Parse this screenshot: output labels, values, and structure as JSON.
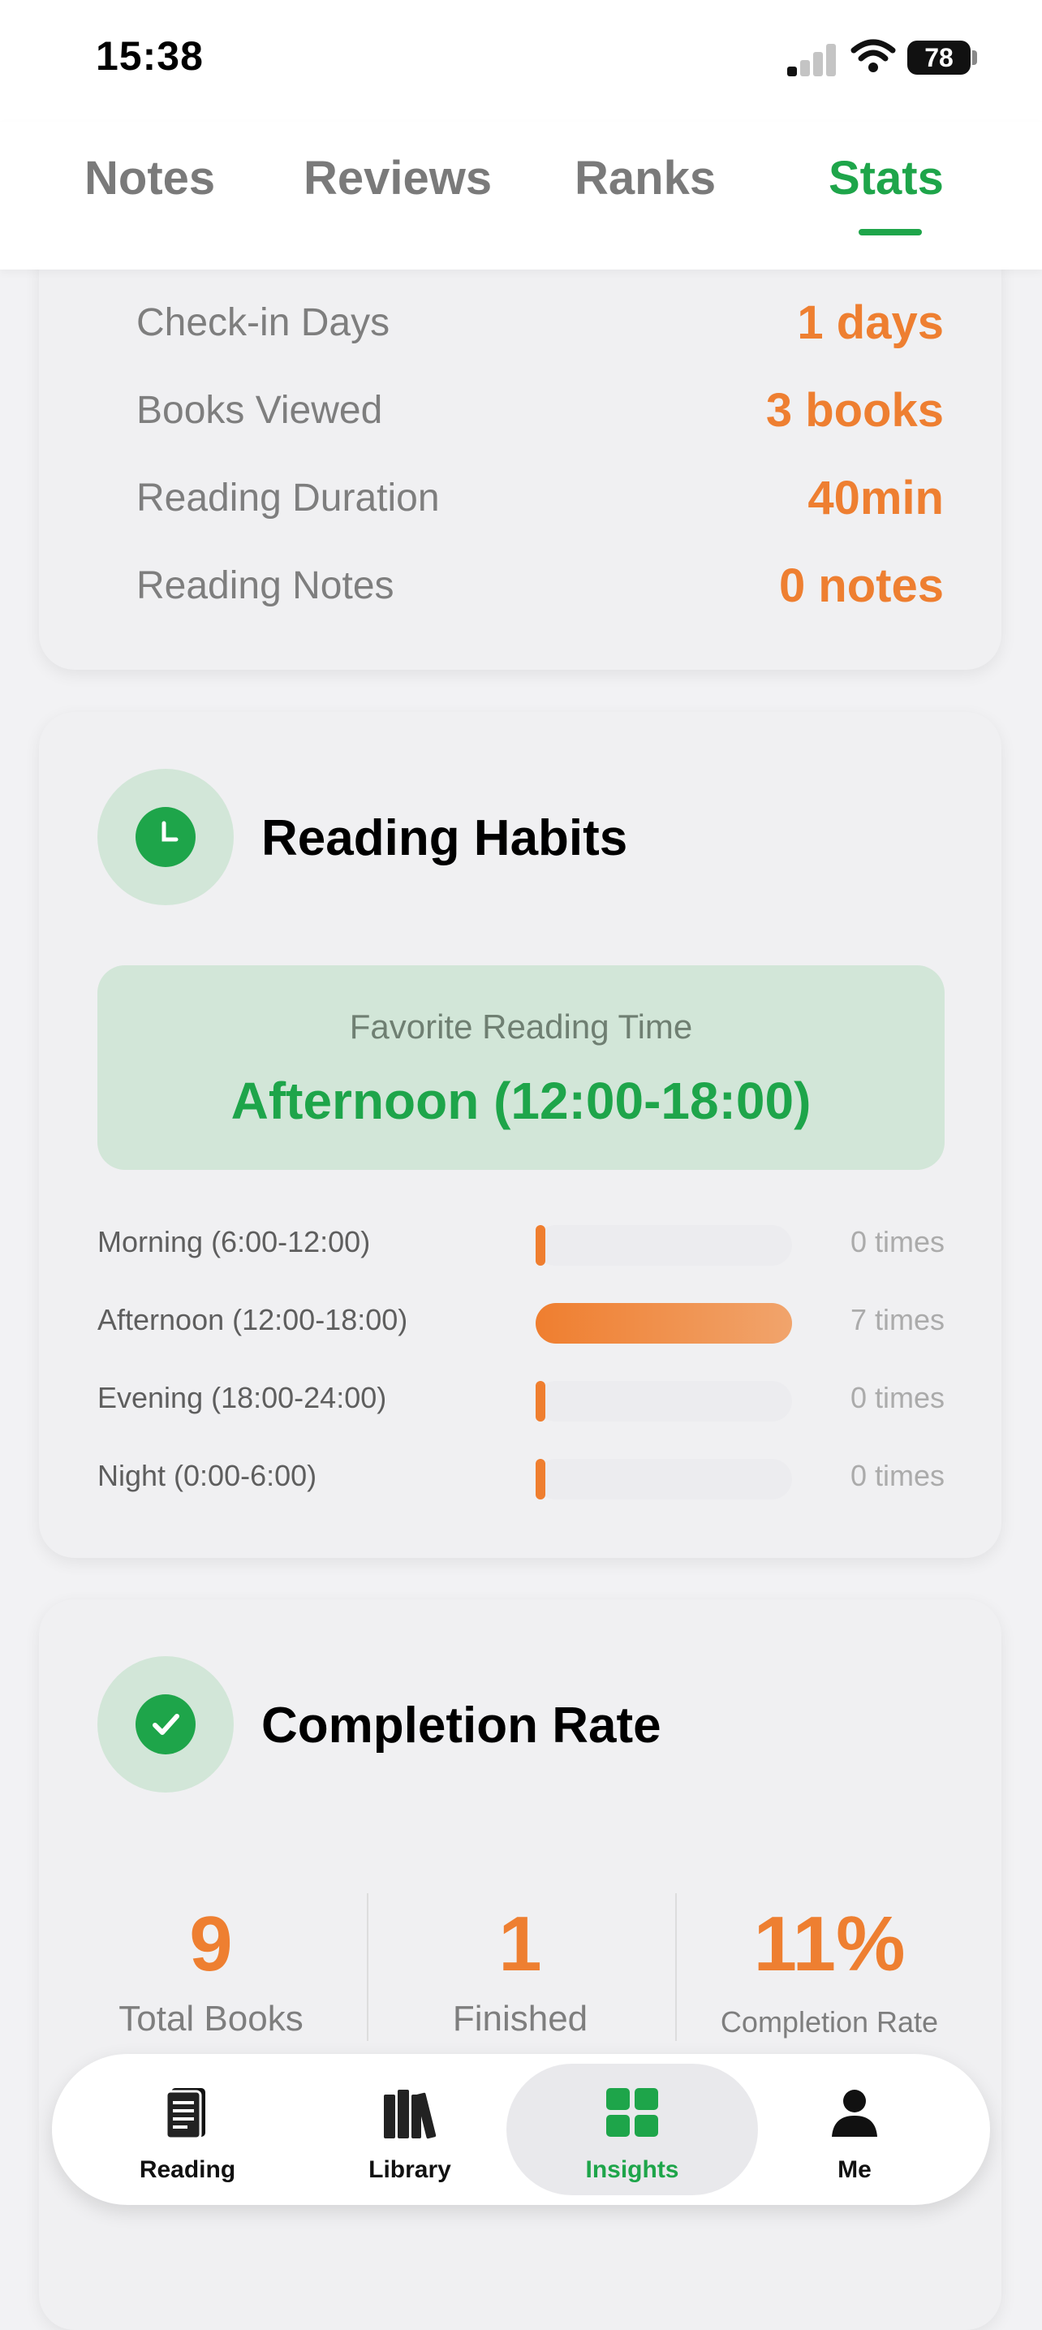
{
  "status_bar": {
    "time": "15:38",
    "battery": "78"
  },
  "top_tabs": [
    {
      "label": "Notes",
      "active": false
    },
    {
      "label": "Reviews",
      "active": false
    },
    {
      "label": "Ranks",
      "active": false
    },
    {
      "label": "Stats",
      "active": true
    }
  ],
  "summary": {
    "rows": [
      {
        "label": "Check-in Days",
        "value": "1 days"
      },
      {
        "label": "Books Viewed",
        "value": "3 books"
      },
      {
        "label": "Reading Duration",
        "value": "40min"
      },
      {
        "label": "Reading Notes",
        "value": "0 notes"
      }
    ]
  },
  "habits": {
    "title": "Reading Habits",
    "favorite_label": "Favorite Reading Time",
    "favorite_value": "Afternoon (12:00-18:00)",
    "rows": [
      {
        "label": "Morning (6:00-12:00)",
        "times": "0 times",
        "count": 0
      },
      {
        "label": "Afternoon (12:00-18:00)",
        "times": "7 times",
        "count": 7
      },
      {
        "label": "Evening (18:00-24:00)",
        "times": "0 times",
        "count": 0
      },
      {
        "label": "Night (0:00-6:00)",
        "times": "0 times",
        "count": 0
      }
    ]
  },
  "completion": {
    "title": "Completion Rate",
    "total_value": "9",
    "total_label": "Total Books",
    "finished_value": "1",
    "finished_label": "Finished",
    "rate_value": "11%",
    "rate_label": "Completion Rate"
  },
  "bottom_nav": [
    {
      "label": "Reading",
      "icon": "book-icon",
      "active": false
    },
    {
      "label": "Library",
      "icon": "bookshelf-icon",
      "active": false
    },
    {
      "label": "Insights",
      "icon": "grid-icon",
      "active": true
    },
    {
      "label": "Me",
      "icon": "person-icon",
      "active": false
    }
  ],
  "colors": {
    "accent_green": "#1ea54a",
    "accent_orange": "#ee7f31"
  }
}
